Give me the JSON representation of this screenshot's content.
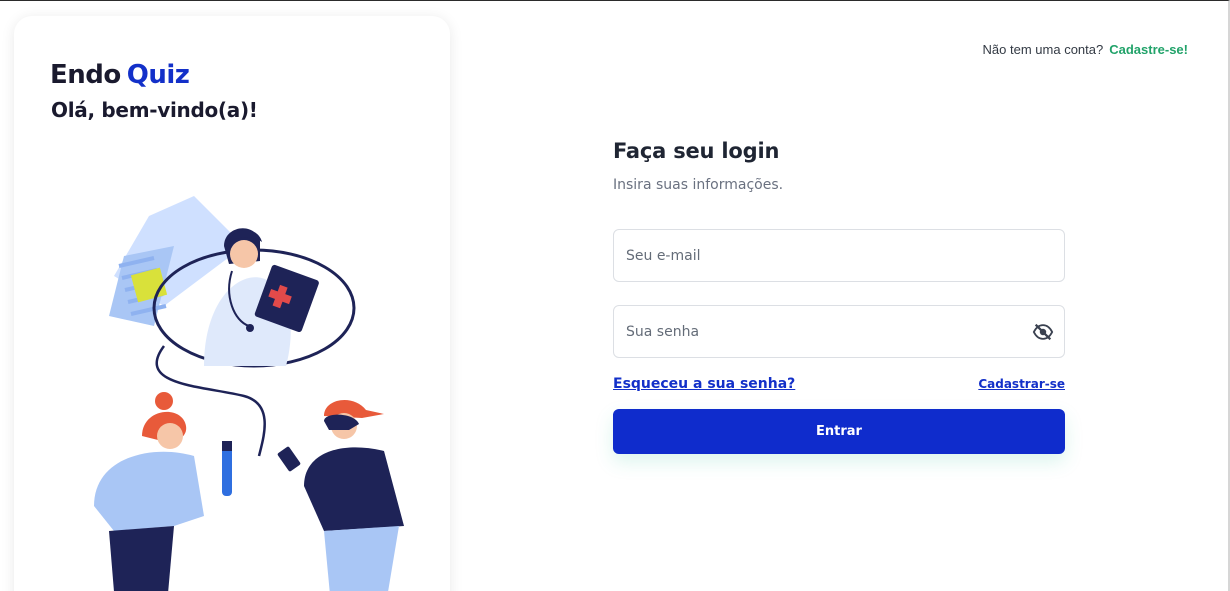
{
  "brand": {
    "logo_part1": "Endo",
    "logo_part2": "Quiz",
    "greeting": "Olá, bem-vindo(a)!"
  },
  "header": {
    "no_account_text": "Não tem uma conta?",
    "signup_link": "Cadastre-se!"
  },
  "login": {
    "title": "Faça seu login",
    "subtitle": "Insira suas informações.",
    "email_placeholder": "Seu e-mail",
    "email_value": "",
    "password_placeholder": "Sua senha",
    "password_value": "",
    "forgot_password": "Esqueceu a sua senha?",
    "register_link": "Cadastrar-se",
    "submit_label": "Entrar"
  },
  "icons": {
    "password_toggle": "eye-off-icon"
  },
  "colors": {
    "primary": "#0f2ccc",
    "link": "#1330c9",
    "accent_green": "#22a36a",
    "heading": "#1f2533",
    "muted": "#6a7180"
  }
}
